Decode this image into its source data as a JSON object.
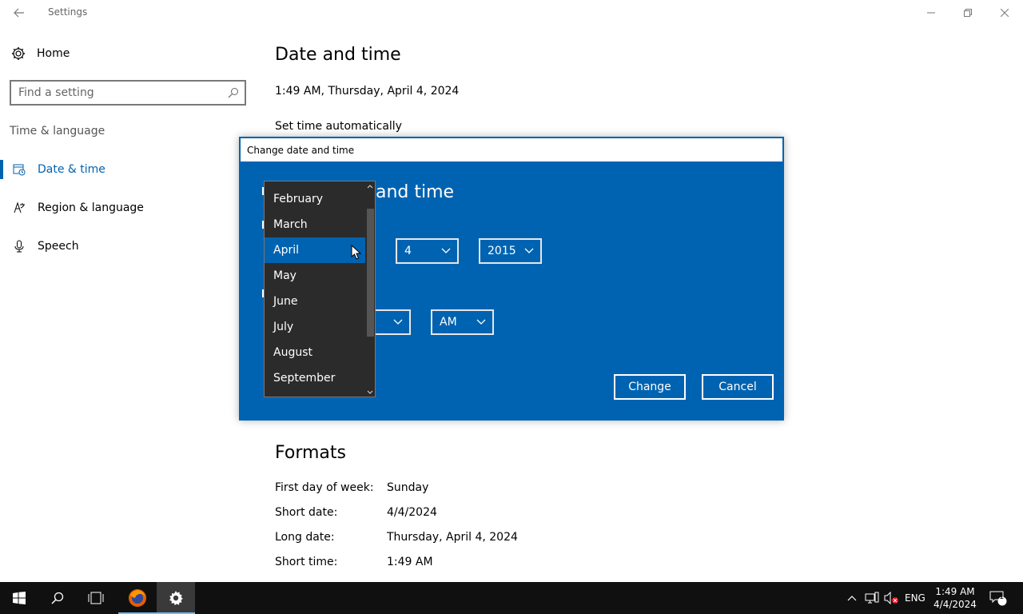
{
  "window": {
    "title": "Settings"
  },
  "sidebar": {
    "home_label": "Home",
    "search_placeholder": "Find a setting",
    "section_label": "Time & language",
    "items": [
      {
        "label": "Date & time",
        "icon": "calendar-clock-icon",
        "active": true
      },
      {
        "label": "Region & language",
        "icon": "language-icon",
        "active": false
      },
      {
        "label": "Speech",
        "icon": "microphone-icon",
        "active": false
      }
    ]
  },
  "main": {
    "title": "Date and time",
    "current_time": "1:49 AM, Thursday, April 4, 2024",
    "set_time_automatically": "Set time automatically",
    "formats_title": "Formats",
    "formats": [
      {
        "key": "First day of week:",
        "value": "Sunday"
      },
      {
        "key": "Short date:",
        "value": "4/4/2024"
      },
      {
        "key": "Long date:",
        "value": "Thursday, April 4, 2024"
      },
      {
        "key": "Short time:",
        "value": "1:49 AM"
      }
    ]
  },
  "dialog": {
    "title": "Change date and time",
    "heading_visible": "and time",
    "day_value": "4",
    "year_value": "2015",
    "ampm_value": "AM",
    "change_label": "Change",
    "cancel_label": "Cancel"
  },
  "month_dropdown": {
    "items": [
      "February",
      "March",
      "April",
      "May",
      "June",
      "July",
      "August",
      "September"
    ],
    "selected": "April"
  },
  "taskbar": {
    "language": "ENG",
    "time": "1:49 AM",
    "date": "4/4/2024",
    "notification_count": "1"
  },
  "colors": {
    "accent": "#0063b1",
    "dropdown_bg": "#2b2b2b",
    "taskbar_bg": "#101010"
  }
}
